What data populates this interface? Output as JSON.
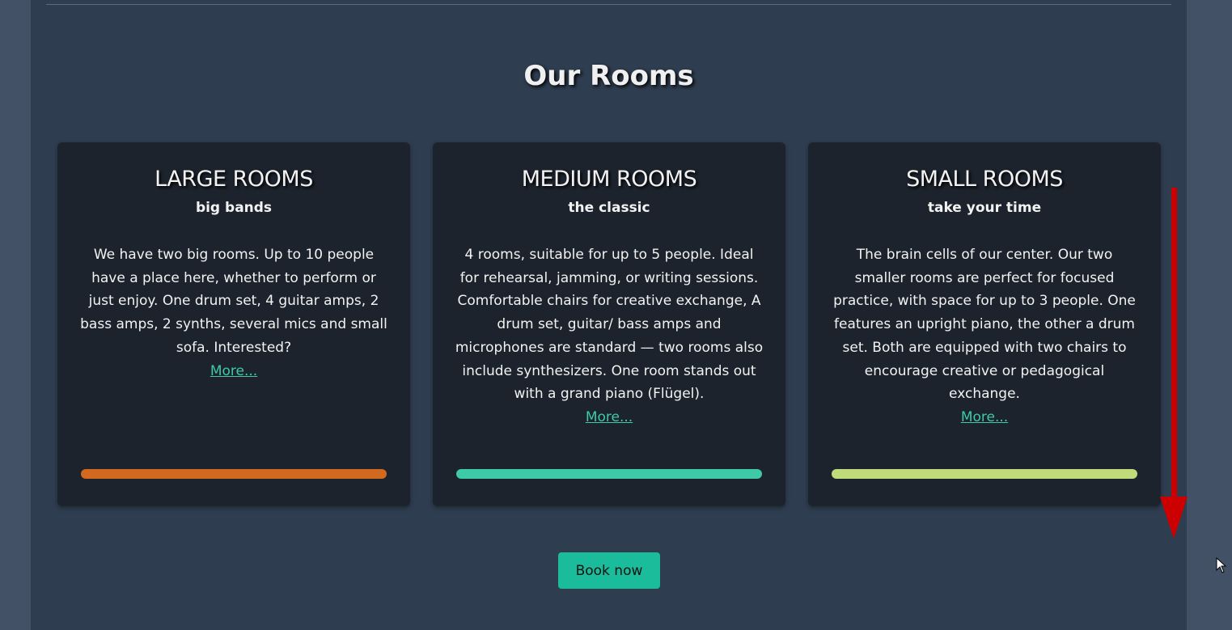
{
  "section_title": "Our Rooms",
  "rooms": [
    {
      "title": "LARGE ROOMS",
      "subtitle": "big bands",
      "text": "We have two big rooms. Up to 10 people have a place here, whether to perform or just enjoy. One drum set, 4 guitar amps, 2 bass amps, 2 synths, several mics and small sofa. Interested?",
      "link": "More...",
      "color": "#d2691e"
    },
    {
      "title": "MEDIUM ROOMS",
      "subtitle": "the classic",
      "text": "4 rooms, suitable for up to 5 people. Ideal for rehearsal, jamming, or writing sessions. Comfortable chairs for creative exchange, A drum set, guitar/ bass amps and microphones are standard — two rooms also include synthesizers. One room stands out with a grand piano (Flügel).",
      "link": "More...",
      "color": "#3ec9a7"
    },
    {
      "title": "SMALL ROOMS",
      "subtitle": "take your time",
      "text": "The brain cells of our center. Our two smaller rooms are perfect for focused practice, with space for up to 3 people. One features an upright piano, the other a drum set. Both are equipped with two chairs to encourage creative or pedagogical exchange.",
      "link": "More...",
      "color": "#c0dc7a"
    }
  ],
  "book_button": "Book now"
}
